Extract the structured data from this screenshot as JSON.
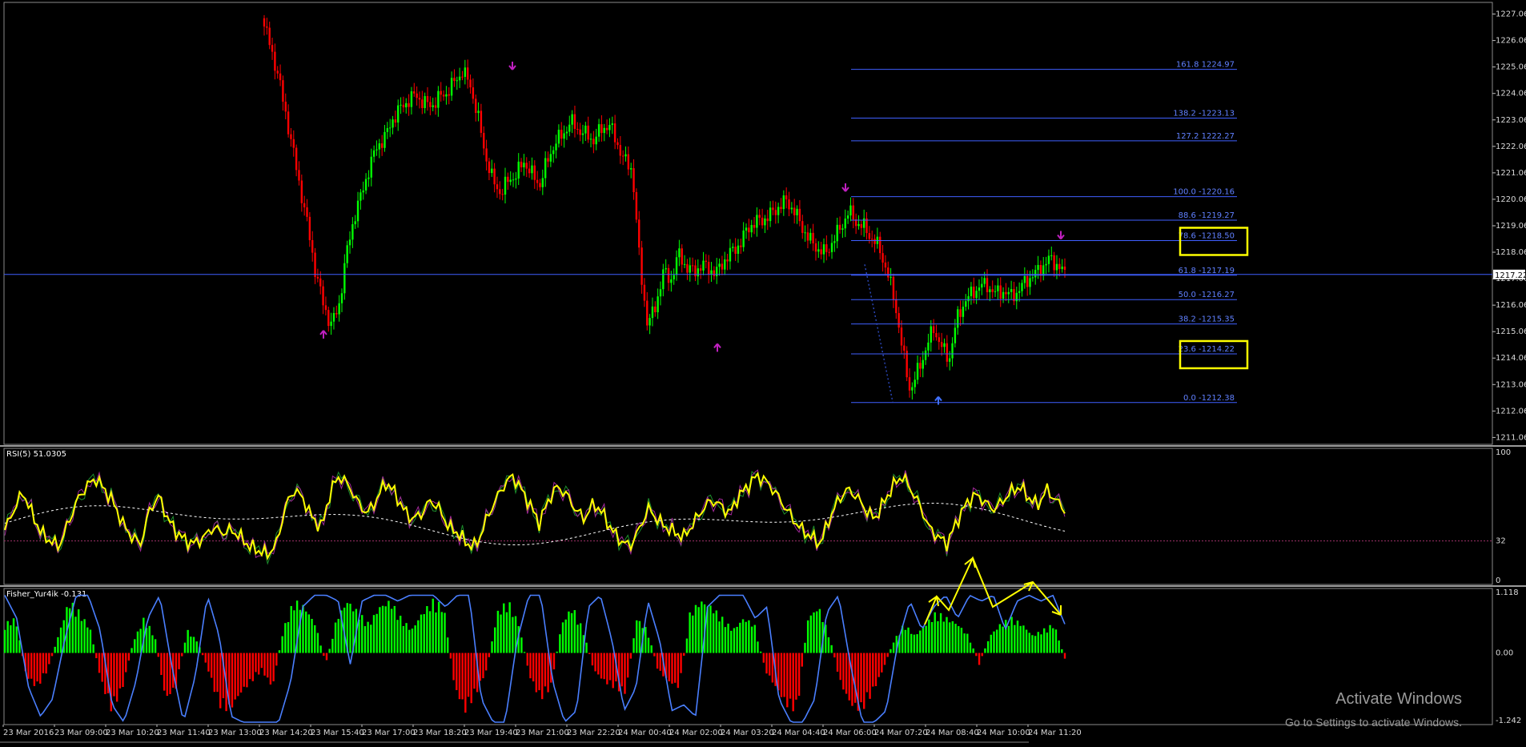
{
  "chart_data": [
    {
      "type": "candlestick",
      "panel": "main",
      "y_ticks": [
        1211.06,
        1212.06,
        1213.06,
        1214.06,
        1215.06,
        1216.06,
        1217.06,
        1218.06,
        1219.06,
        1220.06,
        1221.06,
        1222.06,
        1223.06,
        1224.06,
        1225.06,
        1226.06,
        1227.06
      ],
      "ylim": [
        1210.8,
        1227.5
      ],
      "current_price": "1217.22",
      "current_price_value": 1217.22,
      "price_path": [
        1226.9,
        1226.0,
        1224.9,
        1223.5,
        1222.0,
        1220.5,
        1219.0,
        1217.3,
        1216.1,
        1215.3,
        1216.0,
        1218.0,
        1219.4,
        1220.3,
        1221.3,
        1222.1,
        1222.4,
        1223.1,
        1223.5,
        1223.8,
        1224.0,
        1223.7,
        1223.6,
        1223.9,
        1224.1,
        1224.5,
        1224.9,
        1224.4,
        1223.2,
        1221.7,
        1220.7,
        1220.3,
        1220.8,
        1221.0,
        1221.5,
        1221.0,
        1220.6,
        1221.5,
        1222.2,
        1222.5,
        1223.0,
        1222.7,
        1222.5,
        1222.3,
        1222.7,
        1222.9,
        1222.2,
        1221.5,
        1221.2,
        1217.5,
        1215.3,
        1216.0,
        1217.3,
        1217.0,
        1218.0,
        1217.5,
        1217.3,
        1217.6,
        1217.4,
        1217.3,
        1217.8,
        1218.1,
        1218.4,
        1219.0,
        1219.2,
        1219.3,
        1219.5,
        1219.8,
        1220.0,
        1219.6,
        1219.0,
        1218.5,
        1218.2,
        1218.0,
        1218.5,
        1219.0,
        1219.6,
        1219.2,
        1219.0,
        1218.6,
        1218.2,
        1217.3,
        1216.2,
        1214.3,
        1212.8,
        1213.6,
        1214.4,
        1215.2,
        1214.5,
        1214.0,
        1215.5,
        1216.2,
        1216.5,
        1216.8,
        1216.8,
        1216.5,
        1216.6,
        1216.4,
        1216.6,
        1217.0,
        1217.2,
        1217.5,
        1217.8,
        1217.6,
        1217.22
      ],
      "fibonacci": [
        {
          "level": "161.8",
          "value": "1224.97",
          "label": "161.8 1224.97"
        },
        {
          "level": "138.2",
          "value": "1223.13",
          "label": "138.2 -1223.13"
        },
        {
          "level": "127.2",
          "value": "1222.27",
          "label": "127.2 1222.27"
        },
        {
          "level": "100.0",
          "value": "1220.16",
          "label": "100.0 -1220.16"
        },
        {
          "level": "88.6",
          "value": "1219.27",
          "label": "88.6 -1219.27"
        },
        {
          "level": "78.6",
          "value": "1218.50",
          "label": "78.6 -1218.50"
        },
        {
          "level": "61.8",
          "value": "1217.19",
          "label": "61.8 -1217.19"
        },
        {
          "level": "50.0",
          "value": "1216.27",
          "label": "50.0 -1216.27"
        },
        {
          "level": "38.2",
          "value": "1215.35",
          "label": "38.2 -1215.35"
        },
        {
          "level": "23.6",
          "value": "1214.22",
          "label": "23.6 -1214.22"
        },
        {
          "level": "0.0",
          "value": "1212.38",
          "label": "0.0 -1212.38"
        }
      ],
      "highlighted_levels": [
        "78.6",
        "23.6"
      ]
    },
    {
      "type": "line",
      "panel": "rsi",
      "title": "RSI(5) 51.0305",
      "ylim": [
        0,
        100
      ],
      "y_ticks": [
        "100",
        "32",
        "0"
      ],
      "reference_level": 32,
      "series": [
        {
          "name": "RSI(5)",
          "color": "#ffff00",
          "values": [
            40,
            55,
            68,
            52,
            38,
            32,
            28,
            45,
            62,
            72,
            78,
            70,
            60,
            45,
            35,
            30,
            55,
            65,
            48,
            38,
            32,
            30,
            35,
            42,
            38,
            40,
            35,
            28,
            25,
            22,
            30,
            58,
            70,
            62,
            48,
            42,
            70,
            80,
            72,
            60,
            52,
            62,
            75,
            68,
            55,
            48,
            52,
            62,
            55,
            42,
            38,
            30,
            28,
            45,
            60,
            72,
            80,
            70,
            58,
            45,
            62,
            72,
            66,
            55,
            48,
            60,
            52,
            40,
            32,
            28,
            40,
            56,
            48,
            42,
            38,
            35,
            45,
            55,
            62,
            58,
            52,
            65,
            72,
            80,
            76,
            68,
            58,
            48,
            40,
            35,
            30,
            48,
            62,
            70,
            65,
            55,
            48,
            60,
            72,
            80,
            70,
            58,
            42,
            35,
            30,
            45,
            58,
            66,
            62,
            55,
            60,
            68,
            72,
            64,
            58,
            70,
            62,
            55
          ]
        }
      ]
    },
    {
      "type": "bar",
      "panel": "fisher",
      "title": "Fisher_Yur4ik -0.131",
      "ylim": [
        -1.242,
        1.118
      ],
      "y_ticks": [
        "1.118",
        "0.00",
        "-1.242"
      ],
      "series": [
        {
          "name": "Fisher",
          "color_positive": "#00ff00",
          "color_negative": "#ff0000",
          "values": [
            0.5,
            0.6,
            -0.4,
            -0.6,
            -0.3,
            0.3,
            0.9,
            0.7,
            0.4,
            -0.5,
            -1.0,
            -0.6,
            0.2,
            0.6,
            0.3,
            -0.8,
            -0.6,
            0.4,
            0.2,
            -0.3,
            -0.9,
            -1.0,
            -0.7,
            -0.5,
            -0.3,
            -0.6,
            0.4,
            0.9,
            0.8,
            0.5,
            -0.2,
            0.6,
            0.9,
            0.7,
            0.5,
            0.8,
            0.9,
            0.6,
            0.4,
            0.7,
            0.9,
            0.8,
            -0.6,
            -1.0,
            -0.7,
            -0.3,
            0.7,
            0.9,
            0.5,
            -0.4,
            -0.8,
            -0.6,
            0.5,
            0.8,
            0.4,
            -0.3,
            -0.5,
            -0.6,
            -0.7,
            0.6,
            0.4,
            -0.3,
            -0.5,
            -0.6,
            0.7,
            0.9,
            0.8,
            0.6,
            0.4,
            0.6,
            0.5,
            -0.3,
            -0.6,
            -0.9,
            -1.0,
            0.6,
            0.8,
            0.3,
            -0.5,
            -0.9,
            -1.0,
            -0.7,
            -0.3,
            0.2,
            0.5,
            0.3,
            0.5,
            0.7,
            0.6,
            0.5,
            0.3,
            -0.2,
            0.3,
            0.5,
            0.6,
            0.5,
            0.3,
            0.4,
            0.5,
            -0.1
          ]
        },
        {
          "name": "Signal",
          "color": "#4a7fff",
          "values": [
            1.0,
            0.6,
            -0.6,
            -1.1,
            -0.8,
            0.2,
            1.0,
            1.0,
            0.4,
            -0.9,
            -1.2,
            -0.5,
            0.6,
            1.0,
            -0.2,
            -1.2,
            -0.4,
            1.0,
            0.3,
            -1.1,
            -1.2,
            -1.2,
            -1.2,
            -1.2,
            -0.5,
            0.8,
            1.0,
            1.0,
            0.9,
            -0.2,
            0.9,
            1.0,
            1.0,
            0.9,
            1.0,
            1.0,
            1.0,
            0.8,
            1.0,
            1.0,
            -0.8,
            -1.2,
            -1.2,
            0.2,
            1.0,
            1.0,
            -0.5,
            -1.2,
            -1.0,
            0.8,
            1.0,
            0.2,
            -1.0,
            -0.6,
            0.9,
            0.2,
            -1.0,
            -0.9,
            -1.1,
            0.8,
            1.0,
            1.0,
            1.0,
            0.6,
            0.8,
            -0.8,
            -1.2,
            -1.2,
            -0.8,
            0.7,
            1.0,
            -0.2,
            -1.2,
            -1.2,
            -1.0,
            0.2,
            0.9,
            0.4,
            0.8,
            1.0,
            0.6,
            1.0,
            0.9,
            1.0,
            0.4,
            0.9,
            1.0,
            0.9,
            1.0,
            0.5
          ]
        }
      ]
    }
  ],
  "time_axis": [
    "23 Mar 2016",
    "23 Mar 09:00",
    "23 Mar 10:20",
    "23 Mar 11:40",
    "23 Mar 13:00",
    "23 Mar 14:20",
    "23 Mar 15:40",
    "23 Mar 17:00",
    "23 Mar 18:20",
    "23 Mar 19:40",
    "23 Mar 21:00",
    "23 Mar 22:20",
    "24 Mar 00:40",
    "24 Mar 02:00",
    "24 Mar 03:20",
    "24 Mar 04:40",
    "24 Mar 06:00",
    "24 Mar 07:20",
    "24 Mar 08:40",
    "24 Mar 10:00",
    "24 Mar 11:20"
  ],
  "colors": {
    "bull": "#00ff00",
    "bear": "#ff0000",
    "fib": "#3f5fff",
    "fib_label": "#6080ff",
    "highlight": "#ffff00",
    "grid_text": "#d8d8d8",
    "arrow_top": "#c020c0",
    "arrow_bottom_blue": "#4070ff"
  },
  "watermark": {
    "title": "Activate Windows",
    "subtitle": "Go to Settings to activate Windows."
  }
}
